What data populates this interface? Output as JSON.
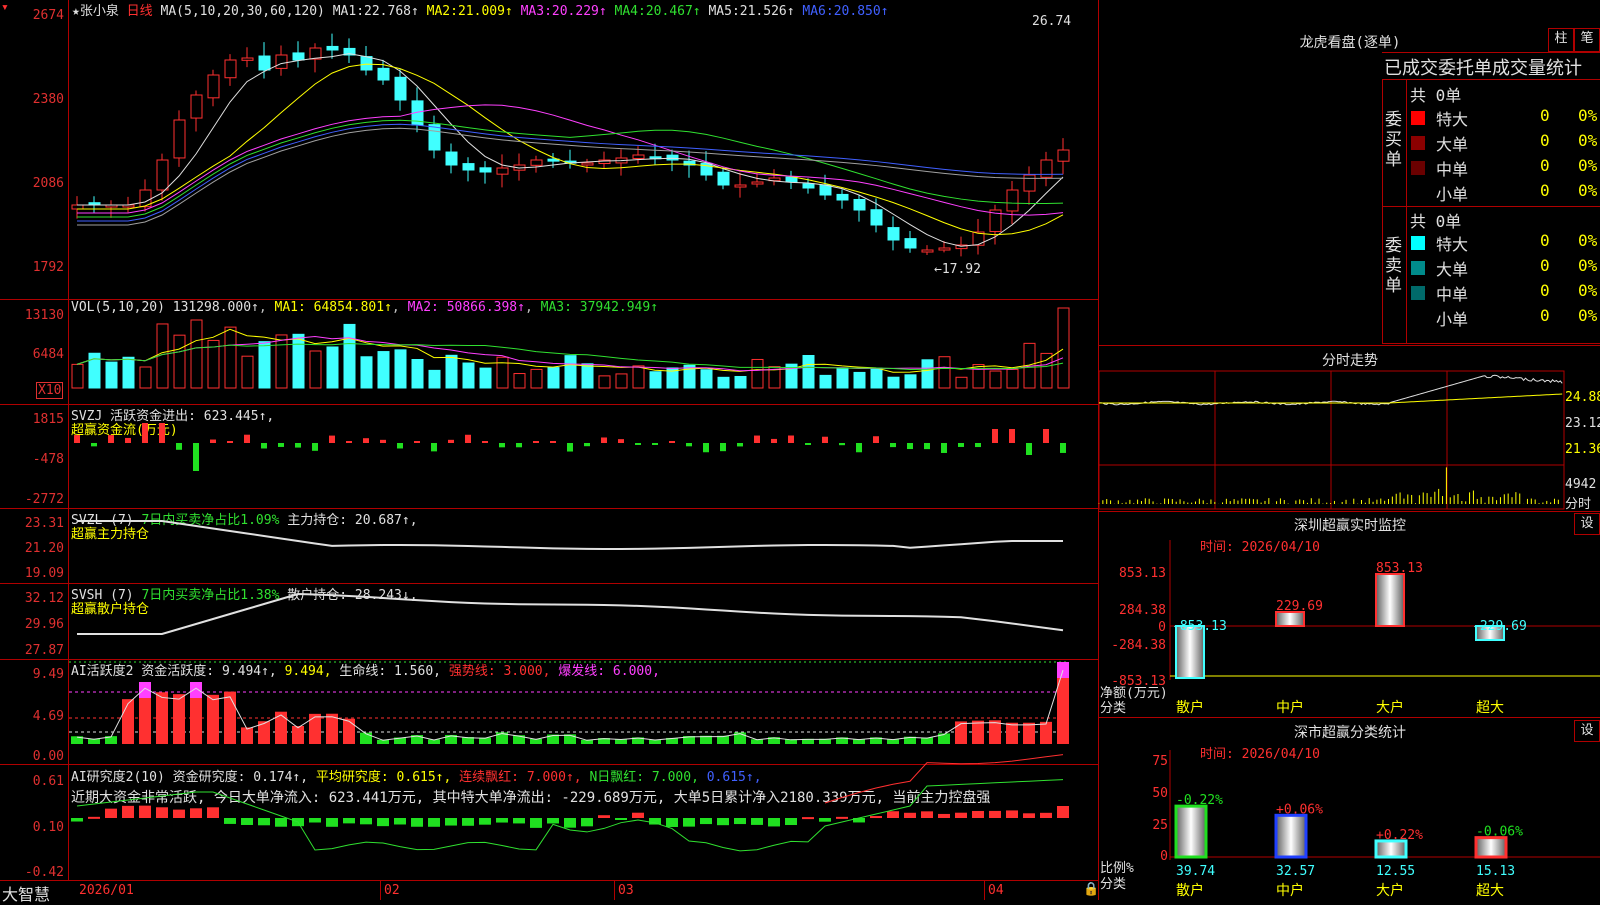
{
  "stock": {
    "star": "★",
    "name": "张小泉",
    "period": "日线"
  },
  "main": {
    "ma_header": "MA(5,10,20,30,60,120)",
    "ma": [
      {
        "k": "MA1:",
        "v": "22.768↑"
      },
      {
        "k": "MA2:",
        "v": "21.009↑"
      },
      {
        "k": "MA3:",
        "v": "20.229↑"
      },
      {
        "k": "MA4:",
        "v": "20.467↑"
      },
      {
        "k": "MA5:",
        "v": "21.526↑"
      },
      {
        "k": "MA6:",
        "v": "20.850↑"
      }
    ],
    "y_ticks": [
      "2674",
      "2380",
      "2086",
      "1792"
    ],
    "high_label": "26.74",
    "low_label": "←17.92"
  },
  "vol": {
    "header": "VOL(5,10,20)",
    "value": "131298.000↑",
    "ma1": "MA1: 64854.801↑",
    "ma2": "MA2: 50866.398↑",
    "ma3": "MA3: 37942.949↑",
    "y_ticks": [
      "13130",
      "6484"
    ],
    "unit": "X10"
  },
  "svzj": {
    "header": "SVZJ  活跃资金进出: 623.445↑,",
    "sub": "超赢资金流(万元)",
    "y_ticks": [
      "1815",
      "-478",
      "-2772"
    ]
  },
  "svzl": {
    "header": "SVZL (7)",
    "pct": "7日内买卖净占比1.09%",
    "hold": "主力持仓: 20.687↑,",
    "sub": "超赢主力持仓",
    "y_ticks": [
      "23.31",
      "21.20",
      "19.09"
    ]
  },
  "svsh": {
    "header": "SVSH (7)",
    "pct": "7日内买卖净占比1.38%",
    "hold": "散户持仓: 28.243↓,",
    "sub": "超赢散户持仓",
    "y_ticks": [
      "32.12",
      "29.96",
      "27.87"
    ]
  },
  "ai1": {
    "header": "AI活跃度2 资金活跃度: 9.494↑,",
    "v2": "9.494,",
    "life": "生命线: 1.560,",
    "strong": "强势线: 3.000,",
    "burst": "爆发线: 6.000,",
    "y_ticks": [
      "9.49",
      "4.69",
      "0.00"
    ]
  },
  "ai2": {
    "header": "AI研究度2(10) 资金研究度: 0.174↑,",
    "avg": "平均研究度: 0.615↑,",
    "lian": "连续飘红: 7.000↑,",
    "nday": "N日飘红: 7.000,",
    "last": "0.615↑,",
    "note": "近期大资金非常活跃, 今日大单净流入: 623.441万元, 其中特大单净流出: -229.689万元, 大单5日累计净入2180.339万元, 当前主力控盘强",
    "y_ticks": [
      "0.61",
      "0.10",
      "-0.42"
    ]
  },
  "xaxis": {
    "brand": "大智慧",
    "months": [
      "2026/01",
      "02",
      "03",
      "04"
    ]
  },
  "lhb": {
    "title": "龙虎看盘(逐单)",
    "btn1": "柱",
    "btn2": "笔",
    "tabs": [
      "已成交",
      "委托单",
      "成交量统计"
    ],
    "buy": {
      "label": "委买单",
      "count": "共 0单",
      "rows": [
        {
          "name": "特大",
          "v": "0",
          "p": "0%",
          "color": "#ff0000"
        },
        {
          "name": "大单",
          "v": "0",
          "p": "0%",
          "color": "#8b0000"
        },
        {
          "name": "中单",
          "v": "0",
          "p": "0%",
          "color": "#6a0000"
        },
        {
          "name": "小单",
          "v": "0",
          "p": "0%",
          "color": "#000000"
        }
      ]
    },
    "sell": {
      "label": "委卖单",
      "count": "共 0单",
      "rows": [
        {
          "name": "特大",
          "v": "0",
          "p": "0%",
          "color": "#00ffff"
        },
        {
          "name": "大单",
          "v": "0",
          "p": "0%",
          "color": "#008b8b"
        },
        {
          "name": "中单",
          "v": "0",
          "p": "0%",
          "color": "#006a6a"
        },
        {
          "name": "小单",
          "v": "0",
          "p": "0%",
          "color": "#000000"
        }
      ]
    }
  },
  "fenshi": {
    "title": "分时走势",
    "y_ticks": [
      "24.88",
      "23.12",
      "21.36"
    ],
    "vol_tick": "4942",
    "unit": "分时"
  },
  "monitor": {
    "title": "深圳超赢实时监控",
    "btn": "设",
    "time": "时间: 2026/04/10",
    "y_ticks": [
      "853.13",
      "284.38",
      "0",
      "-284.38",
      "-853.13"
    ],
    "ylabel1": "净额(万元)",
    "ylabel2": "分类",
    "categories": [
      "散户",
      "中户",
      "大户",
      "超大"
    ],
    "values": [
      -853.13,
      229.69,
      853.13,
      -229.69
    ],
    "labels": [
      "-853.13",
      "229.69",
      "853.13",
      "-229.69"
    ]
  },
  "stat": {
    "title": "深市超赢分类统计",
    "btn": "设",
    "time": "时间: 2026/04/10",
    "y_ticks": [
      "75",
      "50",
      "25",
      "0"
    ],
    "ylabel1": "比例%",
    "ylabel2": "分类",
    "categories": [
      "散户",
      "中户",
      "大户",
      "超大"
    ],
    "values": [
      39.74,
      32.57,
      12.55,
      15.13
    ],
    "changes": [
      "-0.22%",
      "+0.06%",
      "+0.22%",
      "-0.06%"
    ]
  },
  "colors": {
    "up": "#ff3030",
    "down": "#40ffff",
    "grid": "#b00000"
  }
}
